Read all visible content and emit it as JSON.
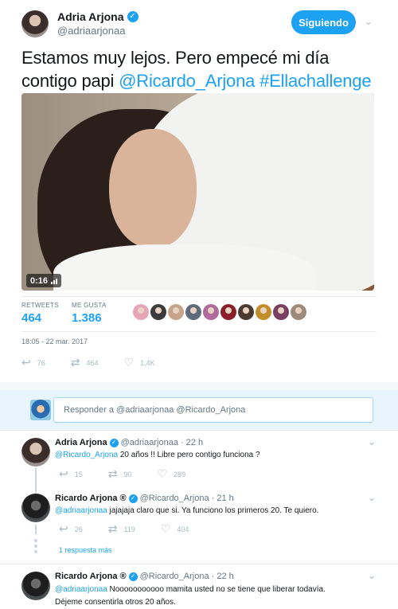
{
  "tweet": {
    "author_name": "Adria Arjona",
    "author_handle": "@adriaarjonaa",
    "follow_label": "Siguiendo",
    "text_prefix": "Estamos muy lejos. Pero empecé mi día contigo papi",
    "mention": "@Ricardo_Arjona",
    "hashtag": "#Ellachallenge",
    "video_duration": "0:16",
    "retweets_label": "RETWEETS",
    "retweets_value": "464",
    "likes_label": "ME GUSTA",
    "likes_value": "1.386",
    "timestamp": "18:05 - 22 mar. 2017",
    "reply_count": "76",
    "retweet_count": "464",
    "like_count": "1,4K",
    "liker_colors": [
      "#e7a6b8",
      "#3b3b3b",
      "#c4a58a",
      "#5d6b7a",
      "#b06a9e",
      "#8a1f2b",
      "#4a3a32",
      "#c38e2a",
      "#7a3f5f",
      "#9d8a7b"
    ]
  },
  "reply_box": {
    "placeholder": "Responder a @adriaarjonaa @Ricardo_Arjona"
  },
  "replies": [
    {
      "name": "Adria Arjona",
      "handle": "@adriaarjonaa",
      "time": "· 22 h",
      "mention": "@Ricardo_Arjona",
      "text": " 20 años !! Libre pero contigo funciona ?",
      "reply_count": "15",
      "retweet_count": "90",
      "like_count": "289"
    },
    {
      "name": "Ricardo Arjona ®",
      "handle": "@Ricardo_Arjona",
      "time": "· 21 h",
      "mention": "@adriaarjonaa",
      "text": " jajajaja claro que si. Ya funciono los primeros 20. Te quiero.",
      "reply_count": "26",
      "retweet_count": "119",
      "like_count": "404"
    },
    {
      "name": "Ricardo Arjona ®",
      "handle": "@Ricardo_Arjona",
      "time": "· 22 h",
      "mention": "@adriaarjonaa",
      "text_line1": " Nooooooooooo mamita usted no se tiene que liberar todavía.",
      "text_line2": "Déjeme consentirla otros 20 años."
    }
  ],
  "more_replies_label": "1 respuesta más",
  "colors": {
    "accent": "#1da1f2",
    "muted": "#657786",
    "icon": "#aab8c2"
  }
}
